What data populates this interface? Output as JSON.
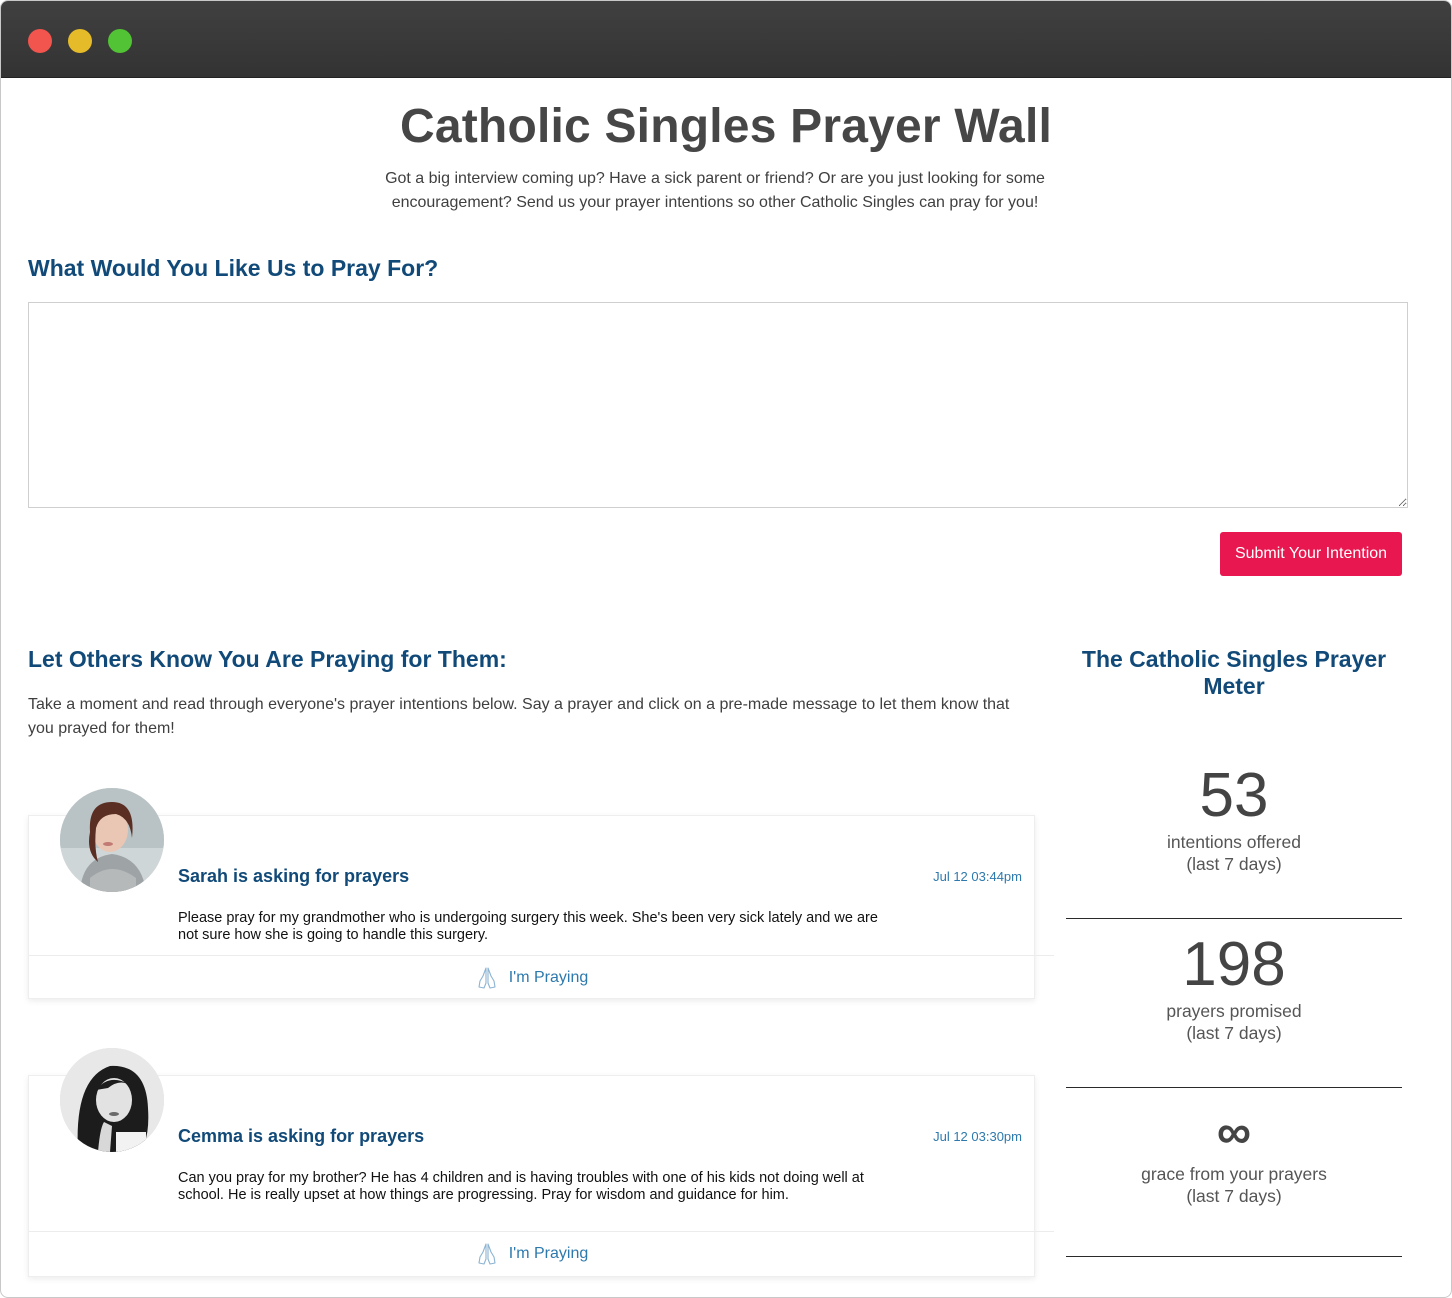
{
  "page": {
    "title": "Catholic Singles Prayer Wall",
    "intro": "Got a big interview coming up? Have a sick parent or friend? Or are you just looking for some encouragement? Send us your prayer intentions so other Catholic Singles can pray for you!"
  },
  "form": {
    "heading": "What Would You Like Us to Pray For?",
    "textarea_value": "",
    "submit_label": "Submit Your Intention",
    "submit_color": "#e8174f"
  },
  "others": {
    "heading": "Let Others Know You Are Praying for Them:",
    "description": "Take a moment and read through everyone's prayer intentions below. Say a prayer and click on a pre-made message to let them know that you prayed for them!"
  },
  "intentions": [
    {
      "name_line": "Sarah is asking for prayers",
      "date": "Jul 12 03:44pm",
      "message": "Please pray for my grandmother who is undergoing surgery this week. She's been very sick lately and we are not sure how she is going to handle this surgery.",
      "button_label": "I'm Praying",
      "avatar_icon": "avatar-photo"
    },
    {
      "name_line": "Cemma is asking for prayers",
      "date": "Jul 12 03:30pm",
      "message": "Can you pray for my brother? He has 4 children and is having troubles with one of his kids not doing well at school. He is really upset at how things are progressing. Pray for wisdom and guidance for him.",
      "button_label": "I'm Praying",
      "avatar_icon": "avatar-photo"
    }
  ],
  "meter": {
    "title": "The Catholic Singles Prayer Meter",
    "stats": [
      {
        "value": "53",
        "label": "intentions offered",
        "period": "(last 7 days)"
      },
      {
        "value": "198",
        "label": "prayers promised",
        "period": "(last 7 days)"
      },
      {
        "value": "∞",
        "label": "grace from your prayers",
        "period": "(last 7 days)"
      }
    ]
  },
  "colors": {
    "heading_blue": "#114a78",
    "link_blue": "#2d79ad",
    "accent_pink": "#e8174f"
  }
}
